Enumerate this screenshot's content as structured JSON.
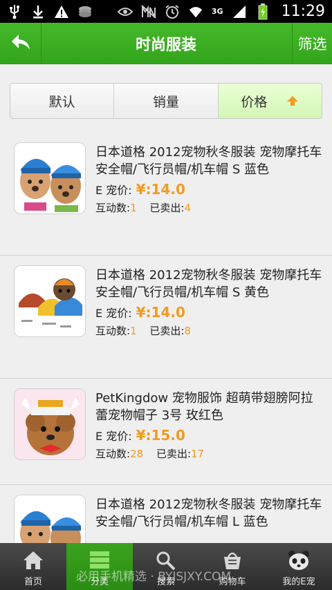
{
  "status_bar": {
    "network": "3G",
    "time": "11:29",
    "icons": [
      "usb-icon",
      "download-icon",
      "warning-icon",
      "storage-icon",
      "eye-icon",
      "mute-icon",
      "alarm-icon",
      "wifi-icon",
      "signal-icon",
      "battery-icon"
    ]
  },
  "header": {
    "title": "时尚服装",
    "filter_label": "筛选",
    "back_icon": "back-arrow-icon"
  },
  "sort_tabs": [
    {
      "label": "默认",
      "active": false
    },
    {
      "label": "销量",
      "active": false
    },
    {
      "label": "价格",
      "active": true
    }
  ],
  "products": [
    {
      "title": "日本道格 2012宠物秋冬服装 宠物摩托车安全帽/飞行员帽/机车帽 S 蓝色",
      "price_label": "E 宠价:",
      "price": "¥:14.0",
      "interactions_label": "互动数:",
      "interactions": "1",
      "sold_label": "已卖出:",
      "sold": "4"
    },
    {
      "title": "日本道格 2012宠物秋冬服装 宠物摩托车安全帽/飞行员帽/机车帽 S 黄色",
      "price_label": "E 宠价:",
      "price": "¥:14.0",
      "interactions_label": "互动数:",
      "interactions": "1",
      "sold_label": "已卖出:",
      "sold": "8"
    },
    {
      "title": "PetKingdow 宠物服饰 超萌带翅膀阿拉蕾宠物帽子 3号 玫红色",
      "price_label": "E 宠价:",
      "price": "¥:15.0",
      "interactions_label": "互动数:",
      "interactions": "28",
      "sold_label": "已卖出:",
      "sold": "17"
    },
    {
      "title": "日本道格 2012宠物秋冬服装 宠物摩托车安全帽/飞行员帽/机车帽 L 蓝色",
      "price_label": "",
      "price": "",
      "interactions_label": "",
      "interactions": "",
      "sold_label": "",
      "sold": ""
    }
  ],
  "bottom_nav": [
    {
      "label": "首页",
      "icon": "home-icon",
      "active": false
    },
    {
      "label": "分类",
      "icon": "category-icon",
      "active": true
    },
    {
      "label": "搜索",
      "icon": "search-icon",
      "active": false
    },
    {
      "label": "购物车",
      "icon": "cart-icon",
      "active": false
    },
    {
      "label": "我的E宠",
      "icon": "panda-icon",
      "active": false
    }
  ],
  "watermark": "必用手机精选 · BYJSJXY.COM",
  "colors": {
    "brand_green": "#3aae22",
    "price_orange": "#f39a1e"
  }
}
